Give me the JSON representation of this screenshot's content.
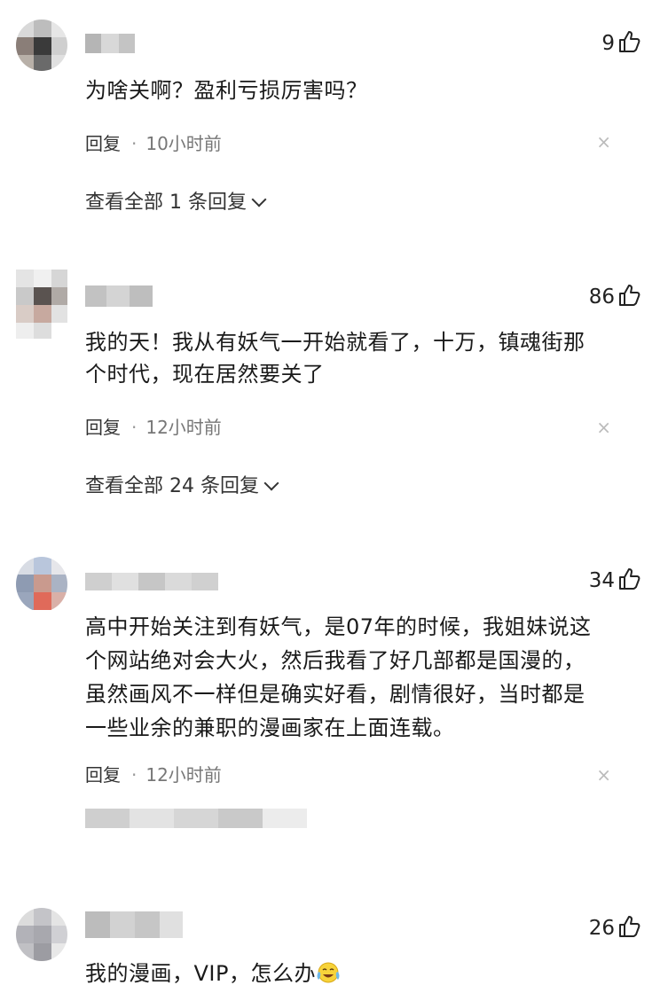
{
  "comments": [
    {
      "likes": "9",
      "text": "为啥关啊？盈利亏损厉害吗？",
      "reply_label": "回复",
      "dot": "·",
      "time": "10小时前",
      "close": "×",
      "expand_label": "查看全部 1 条回复"
    },
    {
      "likes": "86",
      "text_lines": [
        "我的天！我从有妖气一开始就看了，十万，镇魂街那",
        "个时代，现在居然要关了"
      ],
      "reply_label": "回复",
      "dot": "·",
      "time": "12小时前",
      "close": "×",
      "expand_label": "查看全部 24 条回复"
    },
    {
      "likes": "34",
      "text_lines": [
        "高中开始关注到有妖气，是07年的时候，我姐妹说这",
        "个网站绝对会大火，然后我看了好几部都是国漫的，",
        "虽然画风不一样但是确实好看，剧情很好，当时都是",
        "一些业余的兼职的漫画家在上面连载。"
      ],
      "reply_label": "回复",
      "dot": "·",
      "time": "12小时前",
      "close": "×"
    },
    {
      "likes": "26",
      "text": "我的漫画，VIP，怎么办",
      "emoji": "crying-laughing-emoji"
    }
  ],
  "colors": {
    "text": "#1a1a1a",
    "meta": "#777777",
    "mosaic_gray": "#c8c8c8"
  },
  "icons": {
    "like": "thumbs-up-icon",
    "close": "close-icon",
    "expand": "chevron-down-icon"
  }
}
